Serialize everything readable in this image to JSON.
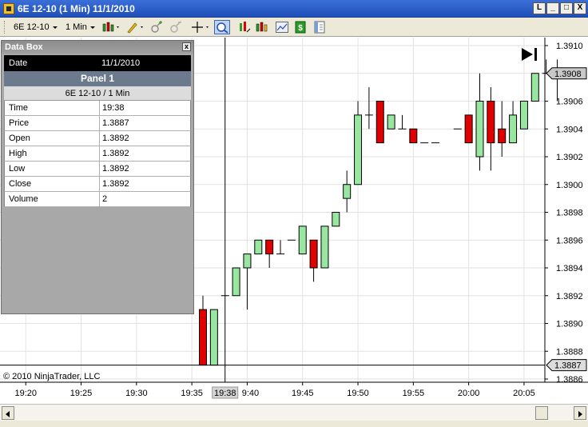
{
  "window": {
    "title": "6E 12-10 (1 Min)  11/1/2010",
    "buttons": [
      "L",
      "_",
      "□",
      "X"
    ]
  },
  "toolbar": {
    "instrument": "6E 12-10",
    "interval": "1 Min",
    "icons": [
      "bar-type-icon",
      "drawing-tool-icon",
      "zoom-in-icon",
      "zoom-out-icon",
      "crosshair-icon",
      "data-box-icon",
      "strategies-icon",
      "indicators-icon",
      "order-entry-icon",
      "properties-icon"
    ]
  },
  "databox": {
    "title": "Data Box",
    "close": "x",
    "date_label": "Date",
    "date_value": "11/1/2010",
    "panel": "Panel 1",
    "instrument": "6E 12-10 / 1 Min",
    "rows": [
      {
        "k": "Time",
        "v": "19:38"
      },
      {
        "k": "Price",
        "v": "1.3887"
      },
      {
        "k": "Open",
        "v": "1.3892"
      },
      {
        "k": "High",
        "v": "1.3892"
      },
      {
        "k": "Low",
        "v": "1.3892"
      },
      {
        "k": "Close",
        "v": "1.3892"
      },
      {
        "k": "Volume",
        "v": "2"
      }
    ]
  },
  "copyright": "© 2010 NinjaTrader, LLC",
  "chart_data": {
    "type": "candlestick",
    "y_ticks": [
      "1.3910",
      "1.3908",
      "1.3906",
      "1.3904",
      "1.3902",
      "1.3900",
      "1.3898",
      "1.3896",
      "1.3894",
      "1.3892",
      "1.3890",
      "1.3888",
      "1.3886"
    ],
    "ylim": [
      1.3885,
      1.3911
    ],
    "x_ticks": [
      "19:20",
      "19:25",
      "19:30",
      "19:35",
      "9:40",
      "19:45",
      "19:50",
      "19:55",
      "20:00",
      "20:05"
    ],
    "cursor_time_label": "19:38",
    "current_price_label": "1.3908",
    "crosshair_price_label": "1.3887",
    "crosshair_price": 1.3887,
    "up_color": "#98e6a0",
    "down_color": "#e00000",
    "candles": [
      {
        "t": "19:36",
        "o": 1.3891,
        "h": 1.3892,
        "l": 1.3887,
        "c": 1.3887
      },
      {
        "t": "19:37",
        "o": 1.3887,
        "h": 1.3891,
        "l": 1.3887,
        "c": 1.3891
      },
      {
        "t": "19:38",
        "o": 1.3892,
        "h": 1.3892,
        "l": 1.3892,
        "c": 1.3892
      },
      {
        "t": "19:39",
        "o": 1.3892,
        "h": 1.3894,
        "l": 1.3892,
        "c": 1.3894
      },
      {
        "t": "19:40",
        "o": 1.3894,
        "h": 1.3895,
        "l": 1.3891,
        "c": 1.3895
      },
      {
        "t": "19:41",
        "o": 1.3895,
        "h": 1.3896,
        "l": 1.3895,
        "c": 1.3896
      },
      {
        "t": "19:42",
        "o": 1.3896,
        "h": 1.3896,
        "l": 1.3894,
        "c": 1.3895
      },
      {
        "t": "19:43",
        "o": 1.3895,
        "h": 1.3896,
        "l": 1.3895,
        "c": 1.3895
      },
      {
        "t": "19:44",
        "o": 1.3896,
        "h": 1.3896,
        "l": 1.3896,
        "c": 1.3896
      },
      {
        "t": "19:45",
        "o": 1.3895,
        "h": 1.3897,
        "l": 1.3895,
        "c": 1.3897
      },
      {
        "t": "19:46",
        "o": 1.3896,
        "h": 1.3896,
        "l": 1.3893,
        "c": 1.3894
      },
      {
        "t": "19:47",
        "o": 1.3894,
        "h": 1.3897,
        "l": 1.3894,
        "c": 1.3897
      },
      {
        "t": "19:48",
        "o": 1.3897,
        "h": 1.3898,
        "l": 1.3897,
        "c": 1.3898
      },
      {
        "t": "19:49",
        "o": 1.3899,
        "h": 1.3901,
        "l": 1.3898,
        "c": 1.39
      },
      {
        "t": "19:50",
        "o": 1.39,
        "h": 1.3906,
        "l": 1.39,
        "c": 1.3905
      },
      {
        "t": "19:51",
        "o": 1.3905,
        "h": 1.3907,
        "l": 1.3904,
        "c": 1.3905
      },
      {
        "t": "19:52",
        "o": 1.3906,
        "h": 1.3906,
        "l": 1.3903,
        "c": 1.3903
      },
      {
        "t": "19:53",
        "o": 1.3904,
        "h": 1.3905,
        "l": 1.3904,
        "c": 1.3905
      },
      {
        "t": "19:54",
        "o": 1.3904,
        "h": 1.3905,
        "l": 1.3904,
        "c": 1.3904
      },
      {
        "t": "19:55",
        "o": 1.3904,
        "h": 1.3904,
        "l": 1.3903,
        "c": 1.3903
      },
      {
        "t": "19:56",
        "o": 1.3903,
        "h": 1.3903,
        "l": 1.3903,
        "c": 1.3903
      },
      {
        "t": "19:57",
        "o": 1.3903,
        "h": 1.3903,
        "l": 1.3903,
        "c": 1.3903
      },
      {
        "t": "19:59",
        "o": 1.3904,
        "h": 1.3904,
        "l": 1.3904,
        "c": 1.3904
      },
      {
        "t": "20:00",
        "o": 1.3905,
        "h": 1.3905,
        "l": 1.3903,
        "c": 1.3903
      },
      {
        "t": "20:01",
        "o": 1.3902,
        "h": 1.3908,
        "l": 1.3901,
        "c": 1.3906
      },
      {
        "t": "20:02",
        "o": 1.3906,
        "h": 1.3907,
        "l": 1.3901,
        "c": 1.3903
      },
      {
        "t": "20:03",
        "o": 1.3904,
        "h": 1.3906,
        "l": 1.3902,
        "c": 1.3903
      },
      {
        "t": "20:04",
        "o": 1.3903,
        "h": 1.3906,
        "l": 1.3903,
        "c": 1.3905
      },
      {
        "t": "20:05",
        "o": 1.3904,
        "h": 1.3906,
        "l": 1.3904,
        "c": 1.3906
      },
      {
        "t": "20:06",
        "o": 1.3906,
        "h": 1.3908,
        "l": 1.3906,
        "c": 1.3908
      },
      {
        "t": "20:07",
        "o": 1.3908,
        "h": 1.3909,
        "l": 1.3908,
        "c": 1.3908
      },
      {
        "t": "20:08",
        "o": 1.3908,
        "h": 1.3909,
        "l": 1.3906,
        "c": 1.3908
      }
    ]
  }
}
